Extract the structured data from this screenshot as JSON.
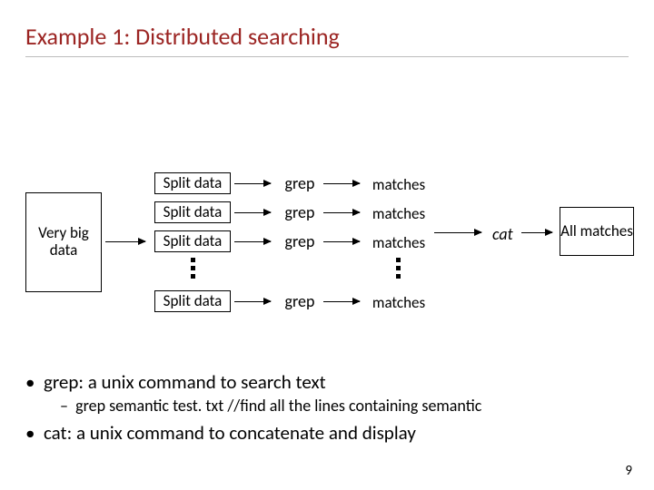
{
  "title": "Example 1: Distributed searching",
  "source": {
    "label": "Very big data"
  },
  "rows": [
    {
      "split": "Split data",
      "op": "grep",
      "out": "matches"
    },
    {
      "split": "Split data",
      "op": "grep",
      "out": "matches"
    },
    {
      "split": "Split data",
      "op": "grep",
      "out": "matches"
    },
    {
      "split": "Split data",
      "op": "grep",
      "out": "matches"
    }
  ],
  "combine": {
    "op": "cat",
    "out": "All matches"
  },
  "bullets": {
    "b1": "grep:  a unix command to search text",
    "sub": "grep semantic test. txt  //find all the lines containing semantic",
    "b2": "cat: a unix command to concatenate and display"
  },
  "slide_num": "9"
}
